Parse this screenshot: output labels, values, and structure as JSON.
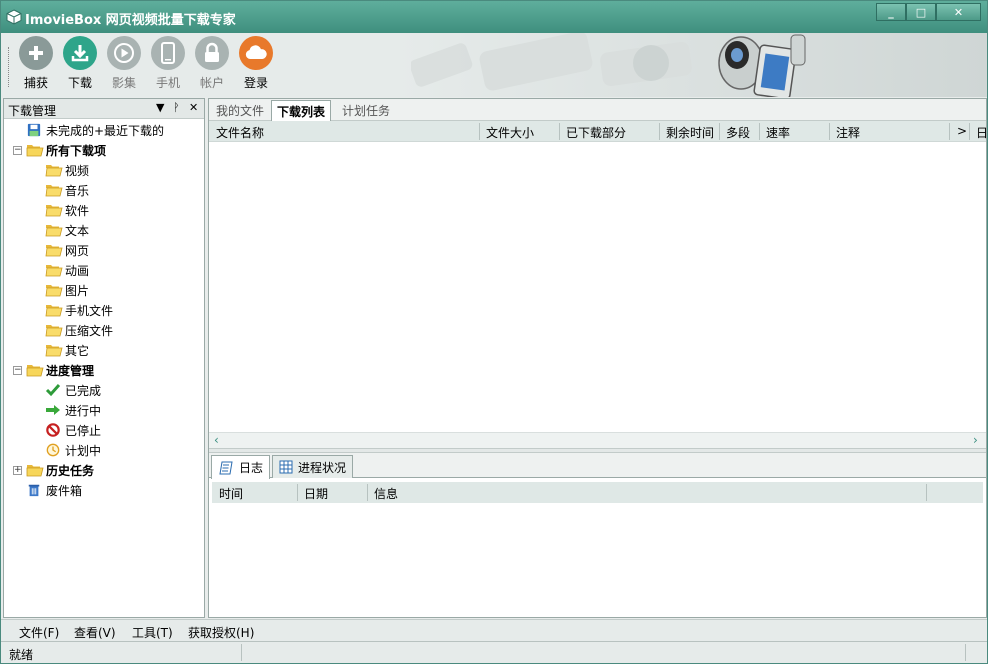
{
  "window": {
    "title": "ImovieBox 网页视频批量下载专家",
    "controls": {
      "minimize": "_",
      "maximize": "□",
      "close": "✕"
    }
  },
  "toolbar": {
    "buttons": [
      {
        "label": "捕获",
        "icon": "plus-icon",
        "color": "#8a9a98",
        "enabled": true
      },
      {
        "label": "下载",
        "icon": "download-icon",
        "color": "#2ea58a",
        "enabled": true
      },
      {
        "label": "影集",
        "icon": "play-icon",
        "color": "#a9b3b2",
        "enabled": false
      },
      {
        "label": "手机",
        "icon": "phone-icon",
        "color": "#a9b3b2",
        "enabled": false
      },
      {
        "label": "帐户",
        "icon": "lock-icon",
        "color": "#a9b3b2",
        "enabled": false
      },
      {
        "label": "登录",
        "icon": "cloud-icon",
        "color": "#e8792b",
        "enabled": true
      }
    ]
  },
  "left_panel": {
    "title": "下载管理",
    "controls": {
      "dropdown": "▼",
      "pin": "ᚹ",
      "close": "✕"
    },
    "tree": [
      {
        "label": "未完成的+最近下载的",
        "icon": "save-icon",
        "bold": false
      },
      {
        "label": "所有下载项",
        "icon": "folder-open-icon",
        "bold": true,
        "expander": "−"
      },
      {
        "label": "视频",
        "icon": "folder-icon",
        "bold": false
      },
      {
        "label": "音乐",
        "icon": "folder-icon",
        "bold": false
      },
      {
        "label": "软件",
        "icon": "folder-icon",
        "bold": false
      },
      {
        "label": "文本",
        "icon": "folder-icon",
        "bold": false
      },
      {
        "label": "网页",
        "icon": "folder-icon",
        "bold": false
      },
      {
        "label": "动画",
        "icon": "folder-icon",
        "bold": false
      },
      {
        "label": "图片",
        "icon": "folder-icon",
        "bold": false
      },
      {
        "label": "手机文件",
        "icon": "folder-icon",
        "bold": false
      },
      {
        "label": "压缩文件",
        "icon": "folder-icon",
        "bold": false
      },
      {
        "label": "其它",
        "icon": "folder-icon",
        "bold": false
      },
      {
        "label": "进度管理",
        "icon": "folder-open-icon",
        "bold": true,
        "expander": "−"
      },
      {
        "label": "已完成",
        "icon": "check-icon",
        "bold": false
      },
      {
        "label": "进行中",
        "icon": "arrow-right-icon",
        "bold": false
      },
      {
        "label": "已停止",
        "icon": "stop-icon",
        "bold": false
      },
      {
        "label": "计划中",
        "icon": "clock-icon",
        "bold": false
      },
      {
        "label": "历史任务",
        "icon": "folder-open-icon",
        "bold": true,
        "expander": "+"
      },
      {
        "label": "废件箱",
        "icon": "trash-icon",
        "bold": false
      }
    ]
  },
  "main": {
    "tabs": [
      {
        "label": "我的文件",
        "active": false
      },
      {
        "label": "下载列表",
        "active": true
      },
      {
        "label": "计划任务",
        "active": false
      }
    ],
    "columns": [
      "文件名称",
      "文件大小",
      "已下载部分",
      "剩余时间",
      "多段",
      "速率",
      "注释",
      ">",
      "日"
    ],
    "scroll_left": "‹",
    "scroll_right": "›"
  },
  "bottom_panel": {
    "tabs": [
      {
        "label": "日志",
        "icon": "log-icon",
        "active": true
      },
      {
        "label": "进程状况",
        "icon": "grid-icon",
        "active": false
      }
    ],
    "columns": [
      "时间",
      "日期",
      "信息"
    ]
  },
  "menubar": [
    "文件(F)",
    "查看(V)",
    "工具(T)",
    "获取授权(H)"
  ],
  "status": {
    "text": "就绪"
  },
  "colors": {
    "title_bar": "#4fa08d",
    "accent_orange": "#e8792b",
    "accent_green": "#2ea58a"
  }
}
